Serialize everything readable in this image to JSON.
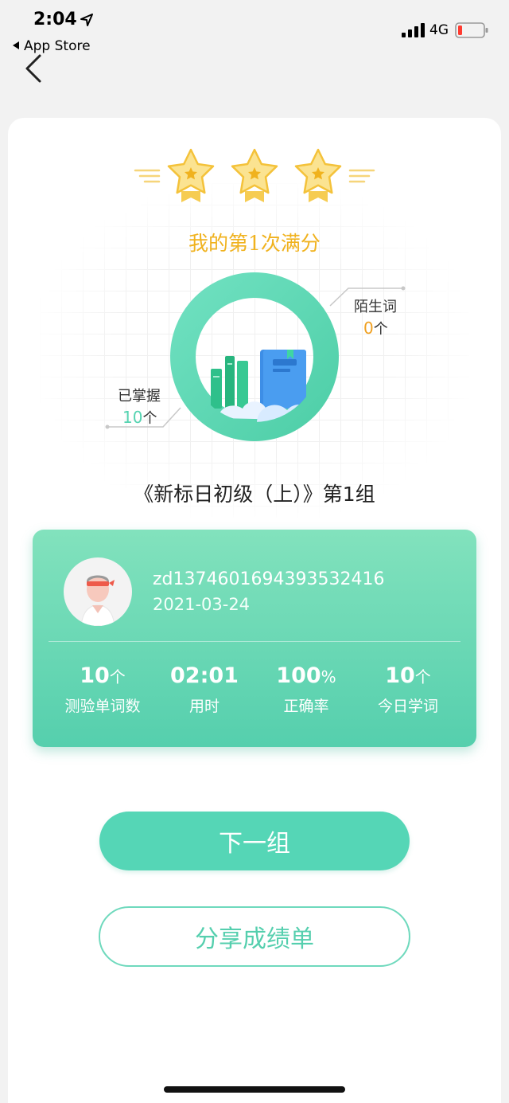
{
  "status_bar": {
    "time": "2:04",
    "back_app_label": "App Store",
    "network": "4G"
  },
  "result": {
    "headline": "我的第1次满分",
    "stars_count": 3,
    "unknown_words": {
      "label": "陌生词",
      "count": "0",
      "unit": "个"
    },
    "mastered_words": {
      "label": "已掌握",
      "count": "10",
      "unit": "个"
    },
    "book_title": "《新标日初级（上）》第1组"
  },
  "user": {
    "username": "zd1374601694393532416",
    "date": "2021-03-24"
  },
  "stats": [
    {
      "value": "10",
      "unit": "个",
      "label": "测验单词数"
    },
    {
      "value": "02:01",
      "unit": "",
      "label": "用时"
    },
    {
      "value": "100",
      "unit": "%",
      "label": "正确率"
    },
    {
      "value": "10",
      "unit": "个",
      "label": "今日学词"
    }
  ],
  "buttons": {
    "next_group": "下一组",
    "share_report": "分享成绩单"
  },
  "colors": {
    "accent_green": "#55d6b6",
    "star_gold": "#f0b21e",
    "unknown_orange": "#f0a020"
  }
}
